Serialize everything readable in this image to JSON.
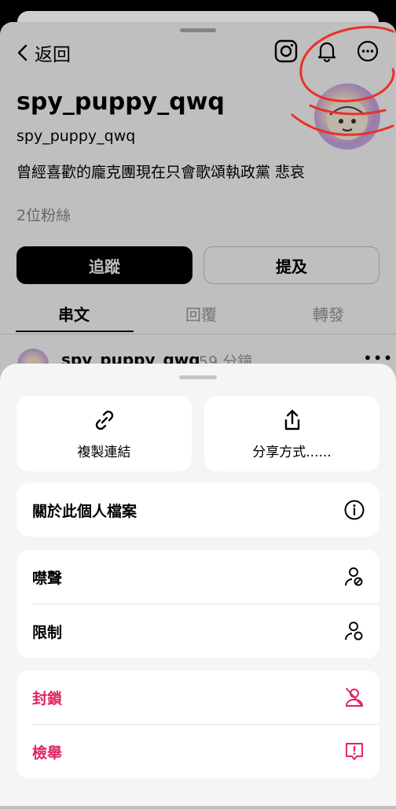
{
  "header": {
    "back_label": "返回"
  },
  "profile": {
    "name": "spy_puppy_qwq",
    "handle": "spy_puppy_qwq",
    "bio": "曾經喜歡的龐克團現在只會歌頌執政黨 悲哀",
    "followers": "2位粉絲"
  },
  "actions": {
    "follow_label": "追蹤",
    "mention_label": "提及"
  },
  "tabs": [
    {
      "label": "串文",
      "active": true
    },
    {
      "label": "回覆",
      "active": false
    },
    {
      "label": "轉發",
      "active": false
    }
  ],
  "post": {
    "author": "spy_puppy_qwq",
    "time": "59 分鐘"
  },
  "sheet": {
    "copy_link_label": "複製連結",
    "share_label": "分享方式......",
    "about_label": "關於此個人檔案",
    "mute_label": "噤聲",
    "restrict_label": "限制",
    "block_label": "封鎖",
    "report_label": "檢舉"
  },
  "colors": {
    "danger": "#e0245e",
    "annotation": "#e8322a"
  }
}
